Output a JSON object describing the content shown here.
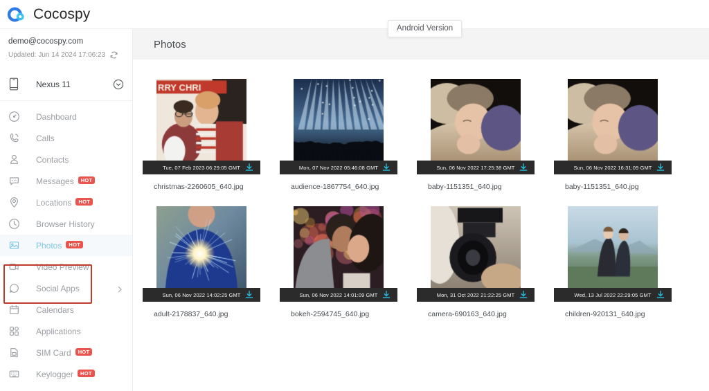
{
  "brand": {
    "name": "Cocospy",
    "logo_icon": "cocospy-cloud-logo"
  },
  "tooltip": {
    "text": "Android Version"
  },
  "account": {
    "email": "demo@cocospy.com",
    "updated_label": "Updated: Jun 14 2024 17:06:23",
    "refresh_icon": "refresh-icon"
  },
  "device": {
    "name": "Nexus 11",
    "phone_icon": "phone-icon",
    "caret_icon": "chevron-down-circle-icon"
  },
  "sidebar": {
    "items": [
      {
        "label": "Dashboard",
        "icon": "dashboard-icon",
        "hot": false,
        "active": false,
        "arrow": false
      },
      {
        "label": "Calls",
        "icon": "phone-call-icon",
        "hot": false,
        "active": false,
        "arrow": false
      },
      {
        "label": "Contacts",
        "icon": "contacts-person-icon",
        "hot": false,
        "active": false,
        "arrow": false
      },
      {
        "label": "Messages",
        "icon": "message-bubble-icon",
        "hot": true,
        "active": false,
        "arrow": false
      },
      {
        "label": "Locations",
        "icon": "location-pin-icon",
        "hot": true,
        "active": false,
        "arrow": false
      },
      {
        "label": "Browser History",
        "icon": "clock-history-icon",
        "hot": false,
        "active": false,
        "arrow": false
      },
      {
        "label": "Photos",
        "icon": "photo-image-icon",
        "hot": true,
        "active": true,
        "arrow": false
      },
      {
        "label": "Video Preview",
        "icon": "video-camera-icon",
        "hot": false,
        "active": false,
        "arrow": false
      },
      {
        "label": "Social Apps",
        "icon": "chat-circle-icon",
        "hot": false,
        "active": false,
        "arrow": true
      },
      {
        "label": "Calendars",
        "icon": "calendar-icon",
        "hot": false,
        "active": false,
        "arrow": false
      },
      {
        "label": "Applications",
        "icon": "apps-grid-icon",
        "hot": false,
        "active": false,
        "arrow": false
      },
      {
        "label": "SIM Card",
        "icon": "sim-card-icon",
        "hot": true,
        "active": false,
        "arrow": false
      },
      {
        "label": "Keylogger",
        "icon": "keyboard-icon",
        "hot": true,
        "active": false,
        "arrow": false
      }
    ],
    "hot_badge_label": "HOT",
    "highlight_color": "#c0392b",
    "active_color": "#7fc7e8"
  },
  "main": {
    "page_title": "Photos",
    "download_icon": "download-icon",
    "photos": [
      {
        "filename": "christmas-2260605_640.jpg",
        "timestamp": "Tue, 07 Feb 2023 06:29:05 GMT",
        "scene": "christmas"
      },
      {
        "filename": "audience-1867754_640.jpg",
        "timestamp": "Mon, 07 Nov 2022 05:46:08 GMT",
        "scene": "audience"
      },
      {
        "filename": "baby-1151351_640.jpg",
        "timestamp": "Sun, 06 Nov 2022 17:25:38 GMT",
        "scene": "baby"
      },
      {
        "filename": "baby-1151351_640.jpg",
        "timestamp": "Sun, 06 Nov 2022 16:31:09 GMT",
        "scene": "baby"
      },
      {
        "filename": "adult-2178837_640.jpg",
        "timestamp": "Sun, 06 Nov 2022 14:02:25 GMT",
        "scene": "sparkler"
      },
      {
        "filename": "bokeh-2594745_640.jpg",
        "timestamp": "Sun, 06 Nov 2022 14:01:09 GMT",
        "scene": "bokeh"
      },
      {
        "filename": "camera-690163_640.jpg",
        "timestamp": "Mon, 31 Oct 2022 21:22:25 GMT",
        "scene": "camera"
      },
      {
        "filename": "children-920131_640.jpg",
        "timestamp": "Wed, 13 Jul 2022 22:29:05 GMT",
        "scene": "children"
      }
    ]
  }
}
